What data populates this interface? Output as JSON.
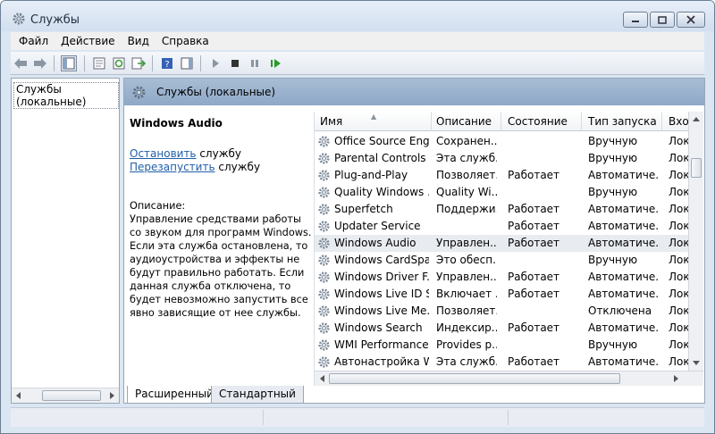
{
  "window": {
    "title": "Службы",
    "icon": "services-gear-icon",
    "controls": {
      "minimize": "minimize-icon",
      "maximize": "maximize-icon",
      "close": "close-icon"
    }
  },
  "menu": {
    "items": [
      "Файл",
      "Действие",
      "Вид",
      "Справка"
    ]
  },
  "toolbar": {
    "buttons": [
      "back-icon",
      "forward-icon",
      "show-hide-tree-icon",
      "properties-icon",
      "refresh-icon",
      "export-icon",
      "help-icon",
      "show-hide-action-pane-icon",
      "start-icon",
      "stop-icon",
      "pause-icon",
      "restart-icon"
    ]
  },
  "tree": {
    "root": "Службы (локальные)"
  },
  "pane": {
    "title": "Службы (локальные)"
  },
  "details": {
    "service_name": "Windows Audio",
    "stop_link": "Остановить",
    "stop_suffix": " службу",
    "restart_link": "Перезапустить",
    "restart_suffix": " службу",
    "description_label": "Описание:",
    "description": "Управление средствами работы со звуком для программ Windows. Если эта служба остановлена, то аудиоустройства и эффекты не будут правильно работать.  Если данная служба отключена, то будет невозможно запустить все явно зависящие от нее службы."
  },
  "services_table": {
    "columns": [
      "Имя",
      "Описание",
      "Состояние",
      "Тип запуска",
      "Вход"
    ],
    "rows": [
      [
        "Office Source Engi...",
        "Сохранен...",
        "",
        "Вручную",
        "Лок"
      ],
      [
        "Parental Controls",
        "Эта служб...",
        "",
        "Вручную",
        "Лок"
      ],
      [
        "Plug-and-Play",
        "Позволяет...",
        "Работает",
        "Автоматиче...",
        "Лок"
      ],
      [
        "Quality Windows ...",
        "Quality Wi...",
        "",
        "Вручную",
        "Лок"
      ],
      [
        "Superfetch",
        "Поддержи...",
        "Работает",
        "Автоматиче...",
        "Лок"
      ],
      [
        "Updater Service",
        "",
        "Работает",
        "Автоматиче...",
        "Лок"
      ],
      [
        "Windows Audio",
        "Управлен...",
        "Работает",
        "Автоматиче...",
        "Лок"
      ],
      [
        "Windows CardSpa...",
        "Это обесп...",
        "",
        "Вручную",
        "Лок"
      ],
      [
        "Windows Driver F...",
        "Управлен...",
        "Работает",
        "Автоматиче...",
        "Лок"
      ],
      [
        "Windows Live ID S...",
        "Включает ...",
        "Работает",
        "Автоматиче...",
        "Лок"
      ],
      [
        "Windows Live Me...",
        "Позволяет...",
        "",
        "Отключена",
        "Лок"
      ],
      [
        "Windows Search",
        "Индексир...",
        "Работает",
        "Автоматиче...",
        "Лок"
      ],
      [
        "WMI Performance...",
        "Provides p...",
        "",
        "Вручную",
        "Лок"
      ],
      [
        "Автонастройка W...",
        "Эта служб...",
        "Работает",
        "Автоматиче...",
        "Лок"
      ]
    ],
    "selected_row": 6
  },
  "tabs": {
    "extended": "Расширенный",
    "standard": "Стандартный"
  },
  "colors": {
    "header_blue": "#9db4cf",
    "link": "#1f5fa8",
    "selection": "#e8ebef"
  }
}
